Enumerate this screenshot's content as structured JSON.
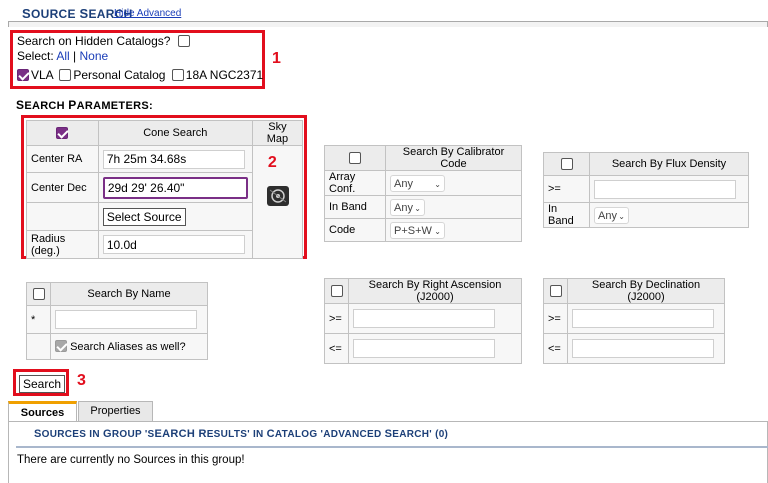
{
  "header": {
    "title_first": "S",
    "title_rest": "OURCE ",
    "title_second": "S",
    "title_rest2": "EARCH",
    "hide_advanced": "Hide Advanced"
  },
  "catalogs": {
    "hidden_label": "Search on Hidden Catalogs?",
    "select_label": "Select:",
    "all": "All",
    "sep": "|",
    "none": "None",
    "items": [
      {
        "label": "VLA",
        "checked": true
      },
      {
        "label": "Personal Catalog",
        "checked": false
      },
      {
        "label": "18A NGC2371",
        "checked": false
      }
    ]
  },
  "annotations": {
    "one": "1",
    "two": "2",
    "three": "3"
  },
  "params_heading": {
    "a": "S",
    "b": "EARCH ",
    "c": "P",
    "d": "ARAMETERS:"
  },
  "cone": {
    "header": "Cone Search",
    "sky_map": "Sky Map",
    "ra_label": "Center RA",
    "ra_value": "7h 25m 34.68s",
    "dec_label": "Center Dec",
    "dec_value": "29d 29' 26.40\"",
    "select_source": "Select Source",
    "radius_label": "Radius (deg.)",
    "radius_value": "10.0d"
  },
  "calibrator": {
    "header": "Search By Calibrator Code",
    "rows": [
      {
        "label": "Array Conf.",
        "value": "Any"
      },
      {
        "label": "In Band",
        "value": "Any"
      },
      {
        "label": "Code",
        "value": "P+S+W"
      }
    ]
  },
  "flux": {
    "header": "Search By Flux Density",
    "ge": ">=",
    "in_band": "In Band",
    "in_band_value": "Any"
  },
  "name_search": {
    "header": "Search By Name",
    "star": "*",
    "aliases": "Search Aliases as well?"
  },
  "ra_search": {
    "header": "Search By Right Ascension (J2000)",
    "ge": ">=",
    "le": "<="
  },
  "dec_search": {
    "header": "Search By Declination (J2000)",
    "ge": ">=",
    "le": "<="
  },
  "search_button": "Search",
  "tabs": {
    "sources": "Sources",
    "properties": "Properties"
  },
  "results": {
    "title_parts": [
      "S",
      "OURCES IN ",
      "G",
      "ROUP 'S",
      "EARCH ",
      "R",
      "ESULTS' IN ",
      "C",
      "ATALOG 'A",
      "DVANCED ",
      "S",
      "EARCH' (0)"
    ],
    "empty": "There are currently no Sources in this group!"
  }
}
